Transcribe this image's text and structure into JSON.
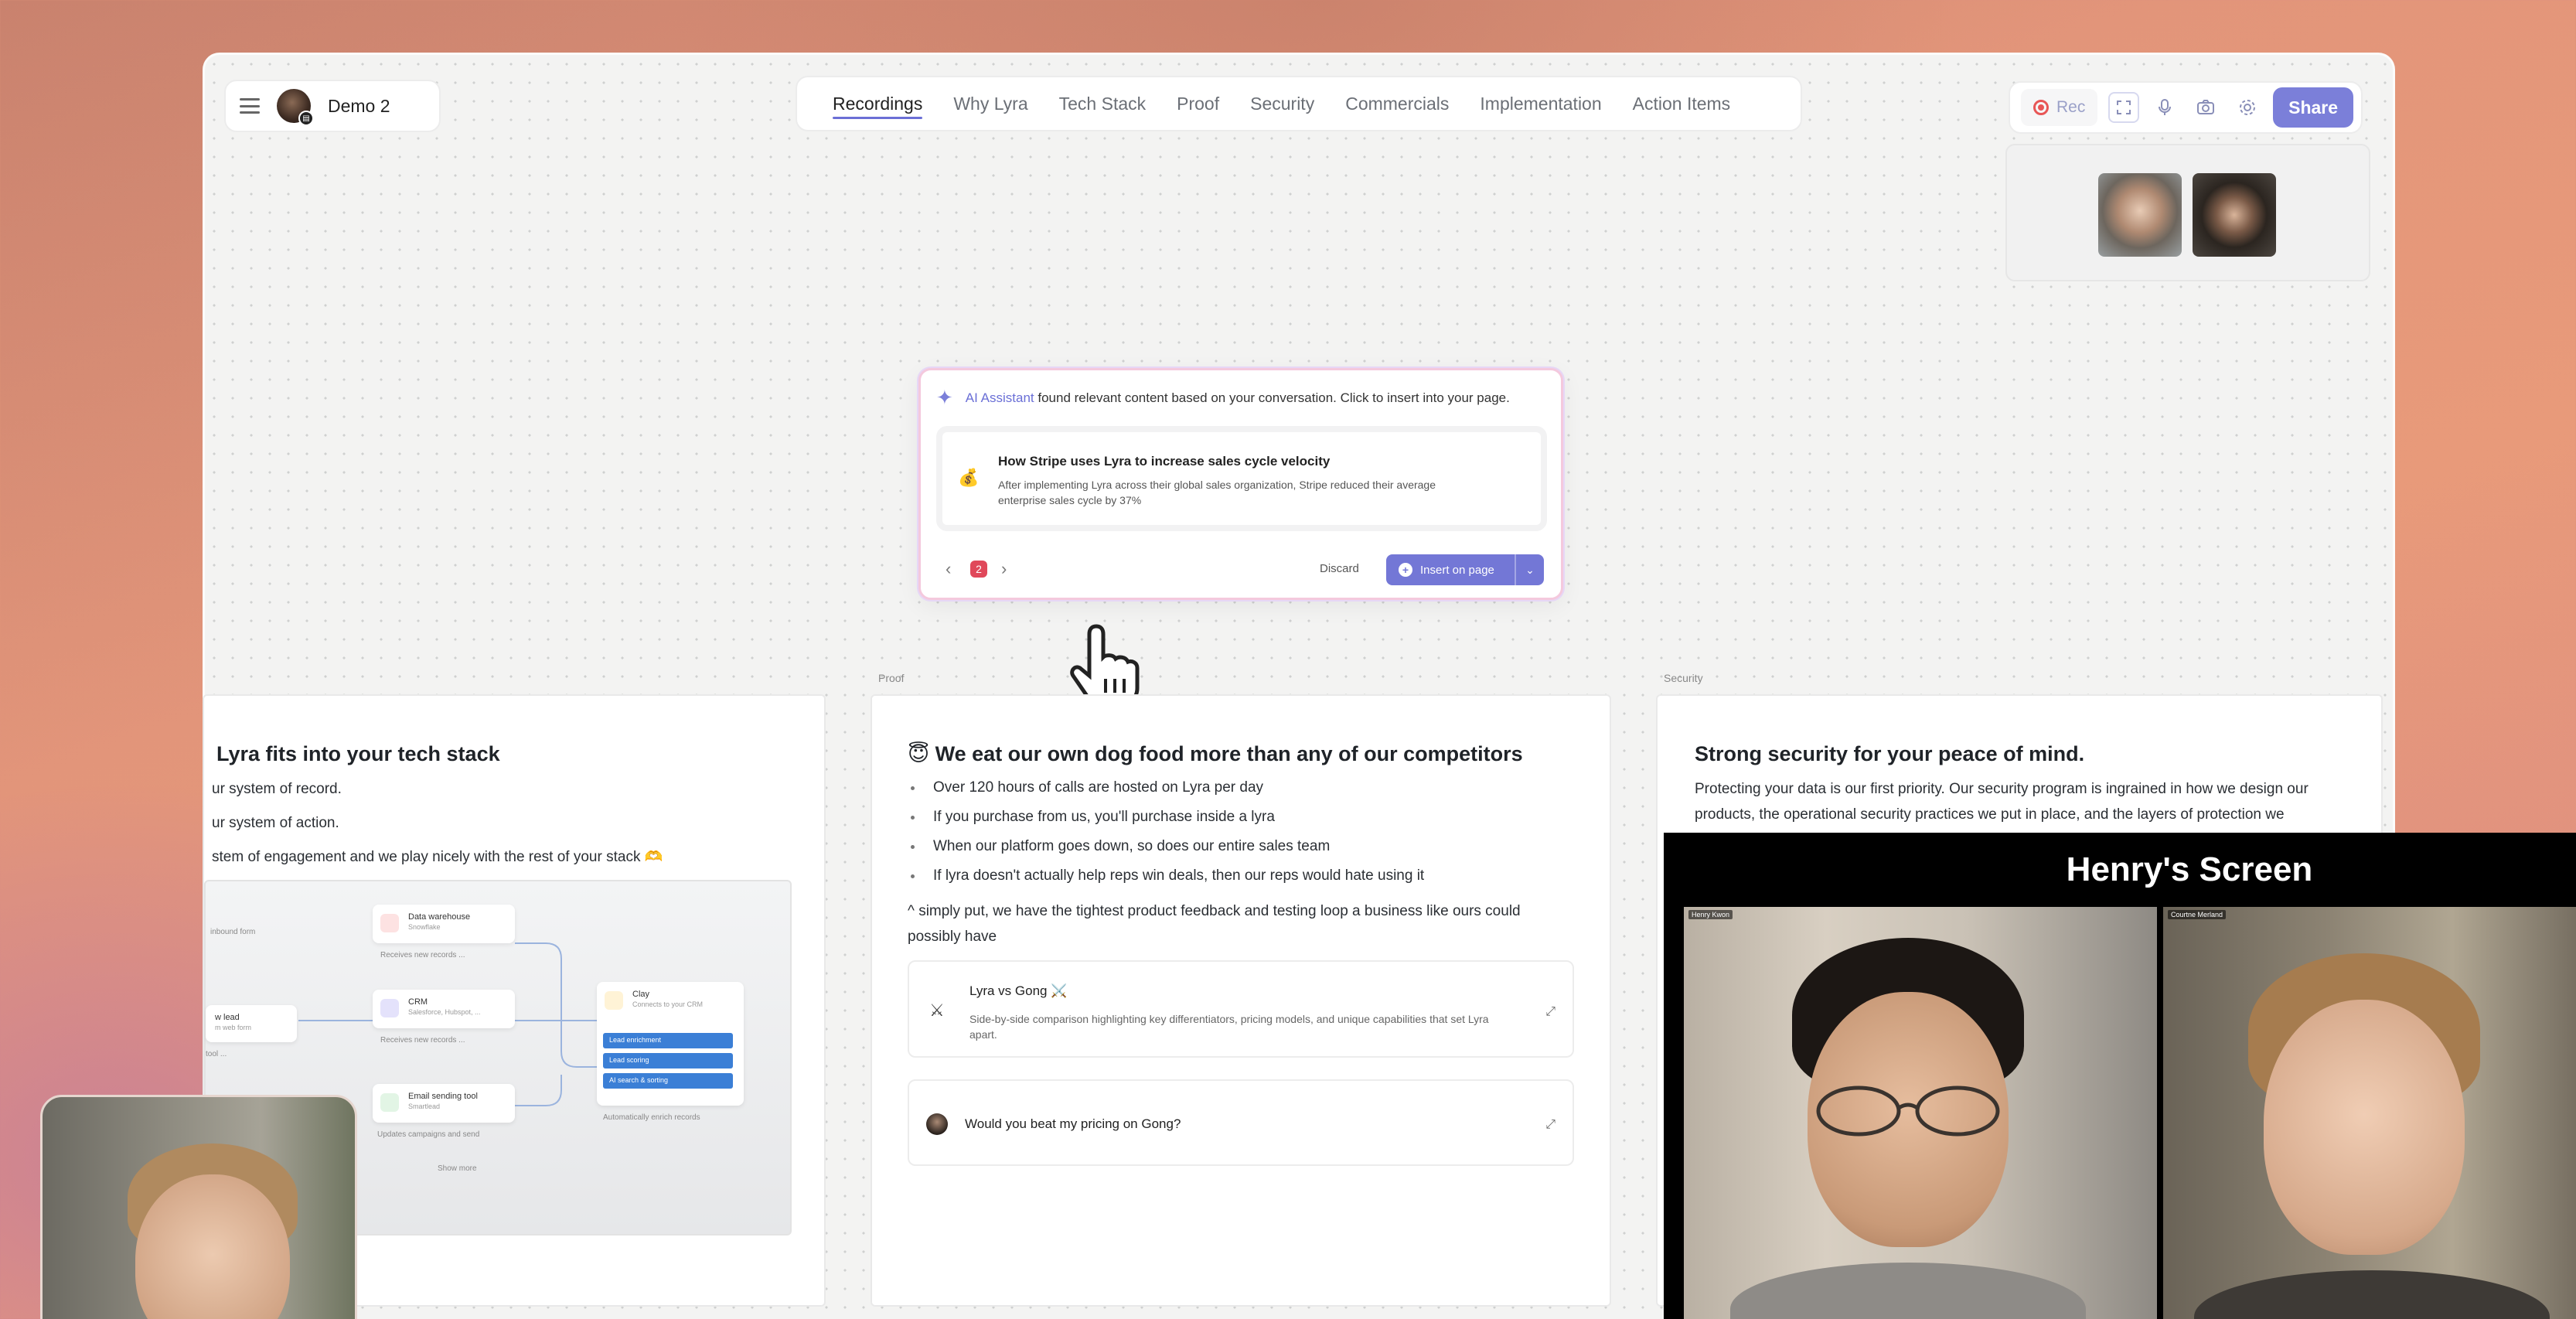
{
  "header": {
    "doc_title": "Demo 2",
    "tabs": [
      "Recordings",
      "Why Lyra",
      "Tech Stack",
      "Proof",
      "Security",
      "Commercials",
      "Implementation",
      "Action Items"
    ],
    "active_tab": "Recordings"
  },
  "controls": {
    "rec_label": "Rec",
    "share_label": "Share"
  },
  "ai_assistant": {
    "name": "AI Assistant",
    "message": "found relevant content based on your conversation. Click to insert into your page.",
    "suggestion_emoji": "💰",
    "suggestion_title": "How Stripe uses Lyra to increase sales cycle velocity",
    "suggestion_desc": "After implementing Lyra across their global sales organization, Stripe reduced their average enterprise sales cycle by 37%",
    "page_count": "2",
    "discard_label": "Discard",
    "insert_label": "Insert on page"
  },
  "sections": {
    "proof_label": "Proof",
    "security_label": "Security"
  },
  "tech_card": {
    "title": "Lyra fits into your tech stack",
    "lines": [
      "ur system of record.",
      "ur system of action.",
      "stem of engagement and we play nicely with the rest of your stack 🫶"
    ],
    "diagram": {
      "data_warehouse": "Data warehouse",
      "data_warehouse_sub": "Snowflake",
      "receives_1": "Receives new records ...",
      "crm": "CRM",
      "crm_sub": "Salesforce, Hubspot, ...",
      "receives_2": "Receives new records ...",
      "email_tool": "Email sending tool",
      "email_tool_sub": "Smartlead",
      "updates": "Updates campaigns and send",
      "clay": "Clay",
      "clay_sub": "Connects to your CRM",
      "enrich_1": "Lead enrichment",
      "enrich_2": "Lead scoring",
      "enrich_3": "AI search & sorting",
      "auto_enrich": "Automatically enrich records",
      "new_lead": "w lead",
      "new_lead_sub": "m web form",
      "show_more": "Show more",
      "tool_side": "tool ...",
      "inbound": "inbound form"
    }
  },
  "proof_card": {
    "title": "😇 We eat our own dog food more than any of our competitors",
    "bullets": [
      "Over 120 hours of calls are hosted on Lyra per day",
      "If you purchase from us, you'll purchase inside a lyra",
      "When our platform goes down, so does our entire sales team",
      "If lyra doesn't actually help reps win deals, then our reps would hate using it"
    ],
    "paragraph": "^ simply put, we have the tightest product feedback and testing loop a business like ours could possibly have",
    "embed_title": "Lyra vs Gong ⚔️",
    "embed_desc": "Side-by-side comparison highlighting key differentiators, pricing models, and unique capabilities that set Lyra apart.",
    "question": "Would you beat my pricing on Gong?"
  },
  "security_card": {
    "title": "Strong security for your peace of mind.",
    "text": "Protecting your data is our first priority. Our security program is ingrained in how we design our products, the operational security practices we put in place, and the layers of protection we"
  },
  "screen_share": {
    "title": "Henry's Screen",
    "left_name": "Henry Kwon",
    "right_name": "Courtne Merland"
  },
  "colors": {
    "accent": "#7b7fd9",
    "rec_red": "#e85656",
    "badge_red": "#e0485a"
  }
}
